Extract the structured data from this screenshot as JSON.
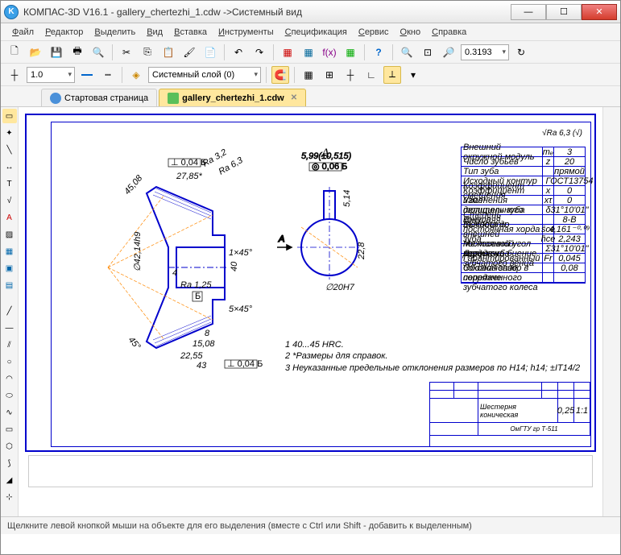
{
  "window": {
    "title": "КОМПАС-3D V16.1 - gallery_chertezhi_1.cdw ->Системный вид",
    "app_icon_letter": "K"
  },
  "menu": [
    "Файл",
    "Редактор",
    "Выделить",
    "Вид",
    "Вставка",
    "Инструменты",
    "Спецификация",
    "Сервис",
    "Окно",
    "Справка"
  ],
  "toolbar1": {
    "line_width": "1.0",
    "zoom_value": "0.3193"
  },
  "toolbar2": {
    "layer": "Системный слой (0)"
  },
  "tabs": [
    {
      "label": "Стартовая страница",
      "active": false
    },
    {
      "label": "gallery_chertezhi_1.cdw",
      "active": true
    }
  ],
  "drawing": {
    "section_label": "А",
    "arrow_label": "А",
    "surface_finish": "√Ra 6,3 (√)",
    "dim_27_85": "27,85*",
    "dim_22_55": "22,55",
    "dim_43": "43",
    "dim_15_08": "15,08",
    "dim_8": "8",
    "dim_4": "4",
    "dim_5x45": "5×45°",
    "dim_1x45": "1×45°",
    "dim_40": "40",
    "dim_angle_45": "45°",
    "dim_d42": "∅42,14h9",
    "dim_d20": "∅20H7",
    "dim_22_8": "22,8",
    "dim_ra125": "Ra 1,25",
    "dim_ra32": "Ra 3,2",
    "dim_ra63": "Ra 6,3",
    "tol_004": "⊥ 0,04 Б",
    "tol_006": "◎ 0,06 Б",
    "tol_004b": "⊥ 0,04 Б",
    "datum_b": "Б",
    "dim_599": "5,99(±0,515)",
    "dim_514": "5,14",
    "dim_4508": "45,08"
  },
  "param_table": [
    {
      "name": "Внешний окружной модуль",
      "sym": "mₑ",
      "val": "3"
    },
    {
      "name": "Число зубьев",
      "sym": "z",
      "val": "20"
    },
    {
      "name": "Тип зуба",
      "sym": "",
      "val": "прямой"
    },
    {
      "name": "Исходный контур",
      "sym": "",
      "val": "ГОСТ13754"
    },
    {
      "name": "Коэффициент смещения",
      "sym": "x",
      "val": "0"
    },
    {
      "name": "Коэффициент изменения толщины зуба",
      "sym": "xτ",
      "val": "0"
    },
    {
      "name": "Угол делительного конуса",
      "sym": "δ",
      "val": "31°10'01\""
    },
    {
      "name": "Степень точности",
      "sym": "",
      "val": "8-В"
    },
    {
      "name": "Внешняя постоянная хорда зуба",
      "sym": "s̄ce",
      "val": "4,161⁻⁰·⁰⁹"
    },
    {
      "name": "Высота до внешней постоянной хорды зуба",
      "sym": "h̄ce",
      "val": "2,243"
    },
    {
      "name": "Межосевой угол передачи",
      "sym": "Σ",
      "val": "31°10'01\""
    },
    {
      "name": "Допуск на биение зубчатого венца",
      "sym": "Fr",
      "val": "0,045"
    },
    {
      "name": "Гарантированный боковой зазор в передаче",
      "sym": "",
      "val": "0,08"
    },
    {
      "name": "Обозначение сопряженного зубчатого колеса",
      "sym": "",
      "val": ""
    }
  ],
  "notes": [
    "1 40...45 HRC.",
    "2 *Размеры для справок.",
    "3 Неуказанные предельные отклонения размеров по H14; h14; ±IT14/2"
  ],
  "titleblock": {
    "part_name": "Шестерня коническая",
    "scale": "1:1",
    "mass": "0,25",
    "org": "ОмГТУ гр Т-511"
  },
  "statusbar": "Щелкните левой кнопкой мыши на объекте для его выделения (вместе с Ctrl или Shift - добавить к выделенным)"
}
